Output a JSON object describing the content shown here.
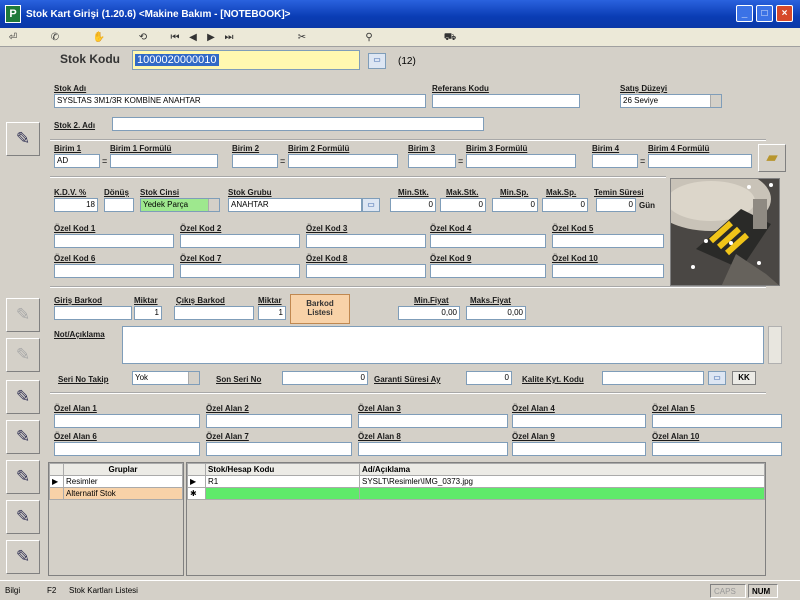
{
  "window": {
    "title": "Stok Kart Girişi (1.20.6) <Makine Bakım - [NOTEBOOK]>",
    "app_icon": "P",
    "minimize": "_",
    "maximize": "□",
    "close": "×"
  },
  "toolbar": [
    "⏎",
    "✆",
    "✋",
    "⟲",
    "⏮",
    "◀",
    "▶",
    "⏭",
    "✂",
    "⚲",
    "⛟"
  ],
  "leftbar": [
    "✎",
    "✎",
    "✎",
    "✎",
    "✎",
    "✎",
    "✎",
    "✎"
  ],
  "header": {
    "stok_kodu_label": "Stok Kodu",
    "stok_kodu_value": "1000020000010",
    "count": "(12)"
  },
  "labels": {
    "stok_adi": "Stok Adı",
    "referans": "Referans Kodu",
    "satis_duzeyi": "Satış Düzeyi",
    "stok2": "Stok 2. Adı",
    "birim1": "Birim 1",
    "birim1f": "Birim 1 Formülü",
    "birim2": "Birim 2",
    "birim2f": "Birim 2 Formülü",
    "birim3": "Birim 3",
    "birim3f": "Birim 3 Formülü",
    "birim4": "Birim 4",
    "birim4f": "Birim 4 Formülü",
    "kdv": "K.D.V. %",
    "donus": "Dönüş",
    "stok_cinsi": "Stok Cinsi",
    "stok_grubu": "Stok Grubu",
    "min_stk": "Min.Stk.",
    "mak_stk": "Mak.Stk.",
    "min_sp": "Min.Sp.",
    "mak_sp": "Mak.Sp.",
    "temin": "Temin Süresi",
    "gun": "Gün",
    "giris_barkod": "Giriş Barkod",
    "miktar1": "Miktar",
    "cikis_barkod": "Çıkış Barkod",
    "miktar2": "Miktar",
    "min_fiyat": "Min.Fiyat",
    "maks_fiyat": "Maks.Fiyat",
    "not": "Not/Açıklama",
    "seri_no_takip": "Seri No Takip",
    "son_seri": "Son Seri No",
    "garanti": "Garanti Süresi Ay",
    "kalite": "Kalite Kyt. Kodu"
  },
  "values": {
    "stok_adi": "SYSLTAS 3M1/3R KOMBİNE ANAHTAR",
    "satis_duzeyi": "26 Seviye",
    "birim1": "AD",
    "kdv": "18",
    "stok_cinsi": "Yedek Parça",
    "stok_grubu": "ANAHTAR",
    "min_stk": "0",
    "mak_stk": "0",
    "min_sp": "0",
    "mak_sp": "0",
    "temin": "0",
    "miktar1": "1",
    "miktar2": "1",
    "min_fiyat": "0,00",
    "maks_fiyat": "0,00",
    "seri_no_takip": "Yok",
    "son_seri": "0",
    "garanti": "0",
    "kk": "KK"
  },
  "barkod_btn": [
    "Barkod",
    "Listesi"
  ],
  "ozel_kod": [
    "Özel Kod 1",
    "Özel Kod 2",
    "Özel Kod 3",
    "Özel Kod 4",
    "Özel Kod 5",
    "Özel Kod 6",
    "Özel Kod 7",
    "Özel Kod 8",
    "Özel Kod 9",
    "Özel Kod 10"
  ],
  "ozel_alan": [
    "Özel Alan 1",
    "Özel Alan 2",
    "Özel Alan 3",
    "Özel Alan 4",
    "Özel Alan 5",
    "Özel Alan 6",
    "Özel Alan 7",
    "Özel Alan 8",
    "Özel Alan 9",
    "Özel Alan 10"
  ],
  "groups": {
    "header": "Gruplar",
    "rows": [
      "Resimler",
      "Alternatif Stok"
    ]
  },
  "files": {
    "col1": "Stok/Hesap Kodu",
    "col2": "Ad/Açıklama",
    "rows": [
      {
        "code": "R1",
        "desc": "SYSLT\\Resimler\\IMG_0373.jpg"
      }
    ]
  },
  "status": {
    "left": "Bilgi",
    "key": "F2",
    "text": "Stok Kartları Listesi",
    "caps": "CAPS",
    "num": "NUM"
  }
}
